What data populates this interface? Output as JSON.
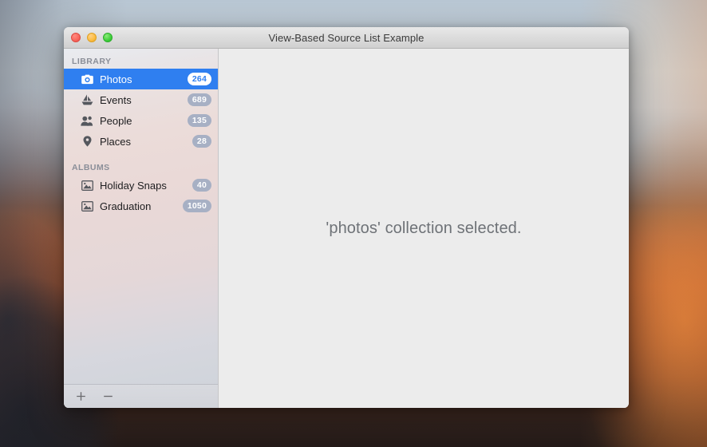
{
  "window": {
    "title": "View-Based Source List Example",
    "traffic_lights": [
      {
        "name": "close",
        "color": "#f9655b"
      },
      {
        "name": "minimize",
        "color": "#fcbc40"
      },
      {
        "name": "zoom",
        "color": "#3fcf3a"
      }
    ]
  },
  "sidebar": {
    "groups": [
      {
        "header": "LIBRARY",
        "items": [
          {
            "label": "Photos",
            "badge": "264",
            "icon": "camera-icon",
            "selected": true
          },
          {
            "label": "Events",
            "badge": "689",
            "icon": "sailboat-icon",
            "selected": false
          },
          {
            "label": "People",
            "badge": "135",
            "icon": "people-icon",
            "selected": false
          },
          {
            "label": "Places",
            "badge": "28",
            "icon": "map-pin-icon",
            "selected": false
          }
        ]
      },
      {
        "header": "ALBUMS",
        "items": [
          {
            "label": "Holiday Snaps",
            "badge": "40",
            "icon": "picture-icon",
            "selected": false
          },
          {
            "label": "Graduation",
            "badge": "1050",
            "icon": "picture-icon",
            "selected": false
          }
        ]
      }
    ],
    "bottom_bar": {
      "add_label": "+",
      "remove_label": "–"
    }
  },
  "content": {
    "message": "'photos' collection selected."
  },
  "colors": {
    "selection_blue": "#2f7ff0",
    "badge_gray": "#a7b0c4",
    "group_header_text": "#8a8e98",
    "content_text": "#6e7277",
    "content_background": "#ececec"
  }
}
